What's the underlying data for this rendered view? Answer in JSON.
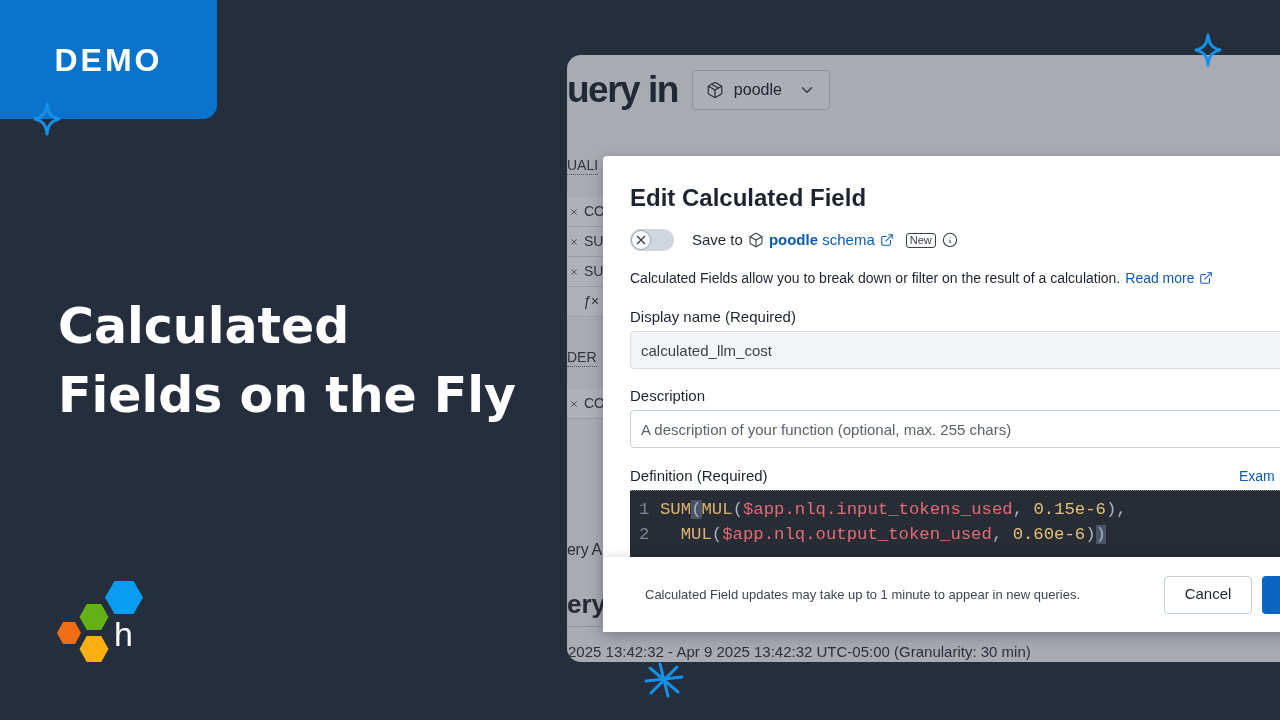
{
  "badge": {
    "label": "DEMO"
  },
  "headline": {
    "lines": [
      "Calculated",
      "Fields on the Fly"
    ]
  },
  "logo": {
    "letter": "h"
  },
  "app": {
    "heading": "uery in",
    "dataset_select": {
      "value": "poodle"
    },
    "sidebar": {
      "sections": [
        {
          "title": "UALI",
          "rows": [
            {
              "kind": "remove",
              "label": "CO"
            },
            {
              "kind": "remove",
              "label": "SU"
            },
            {
              "kind": "remove",
              "label": "SU"
            },
            {
              "kind": "formula",
              "label": "ƒ×"
            }
          ]
        },
        {
          "title": "DER",
          "rows": [
            {
              "kind": "remove",
              "label": "CO"
            }
          ]
        }
      ]
    },
    "results": {
      "subheading": "ery A",
      "heading": "ery"
    },
    "time_range": "2025 13:42:32 - Apr 9 2025 13:42:32 UTC-05:00 (Granularity: 30 min)"
  },
  "dialog": {
    "title": "Edit Calculated Field",
    "save_toggle": {
      "on": false,
      "label": "Save to",
      "schema_link": "**poodle** schema",
      "badge": "New"
    },
    "intro": {
      "text": "Calculated Fields allow you to break down or filter on the result of a calculation.",
      "link": "Read more"
    },
    "fields": [
      {
        "label": "Display name (Required)",
        "value": "calculated_llm_cost",
        "disabled": true
      },
      {
        "label": "Description",
        "placeholder": "A description of your function (optional, max. 255 chars)",
        "disabled": false
      }
    ],
    "definition": {
      "label": "Definition (Required)",
      "link": "Exam",
      "lines": [
        {
          "number": "1",
          "indent": false,
          "tokens": [
            {
              "text": "SUM",
              "kind": "function",
              "highlighted": false
            },
            {
              "text": "(",
              "kind": "punct",
              "highlighted": true
            },
            {
              "text": "MUL",
              "kind": "function",
              "highlighted": false
            },
            {
              "text": "(",
              "kind": "punct",
              "highlighted": false
            },
            {
              "text": "$app.nlq.input_tokens_used",
              "kind": "variable",
              "highlighted": false
            },
            {
              "text": ", ",
              "kind": "punct",
              "highlighted": false
            },
            {
              "text": "0.15e-6",
              "kind": "number",
              "highlighted": false
            },
            {
              "text": "),",
              "kind": "punct",
              "highlighted": false
            }
          ]
        },
        {
          "number": "2",
          "indent": true,
          "tokens": [
            {
              "text": "MUL",
              "kind": "function",
              "highlighted": false
            },
            {
              "text": "(",
              "kind": "punct",
              "highlighted": false
            },
            {
              "text": "$app.nlq.output_token_used",
              "kind": "variable",
              "highlighted": false
            },
            {
              "text": ", ",
              "kind": "punct",
              "highlighted": false
            },
            {
              "text": "0.60e-6",
              "kind": "number",
              "highlighted": false
            },
            {
              "text": ")",
              "kind": "punct",
              "highlighted": false
            },
            {
              "text": ")",
              "kind": "punct",
              "highlighted": true
            }
          ]
        }
      ]
    },
    "footer": {
      "note": "Calculated Field updates may take up to 1 minute to appear in new queries.",
      "buttons": [
        {
          "kind": "secondary",
          "label": "Cancel"
        },
        {
          "kind": "primary"
        }
      ]
    }
  }
}
